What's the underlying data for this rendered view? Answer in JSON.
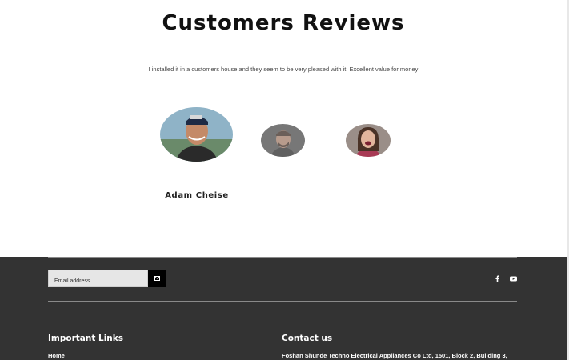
{
  "reviews": {
    "title": "Customers Reviews",
    "quote": "I installed it in a customers house and they seem to be very pleased with it. Excellent value for money",
    "active_reviewer": "Adam Cheise",
    "avatars": [
      {
        "icon": "man-cap-avatar",
        "active": true
      },
      {
        "icon": "man-beard-avatar",
        "active": false
      },
      {
        "icon": "woman-smiling-avatar",
        "active": false
      }
    ]
  },
  "footer": {
    "newsletter": {
      "placeholder": "Email address",
      "submit_icon": "envelope-icon"
    },
    "social": [
      {
        "icon": "facebook-icon"
      },
      {
        "icon": "youtube-icon"
      }
    ],
    "important_links": {
      "title": "Important Links",
      "links": [
        "Home"
      ]
    },
    "contact": {
      "title": "Contact us",
      "address": "Foshan Shunde Techno Electrical Appliances Co Ltd, 1501, Block 2, Building 3,"
    }
  }
}
